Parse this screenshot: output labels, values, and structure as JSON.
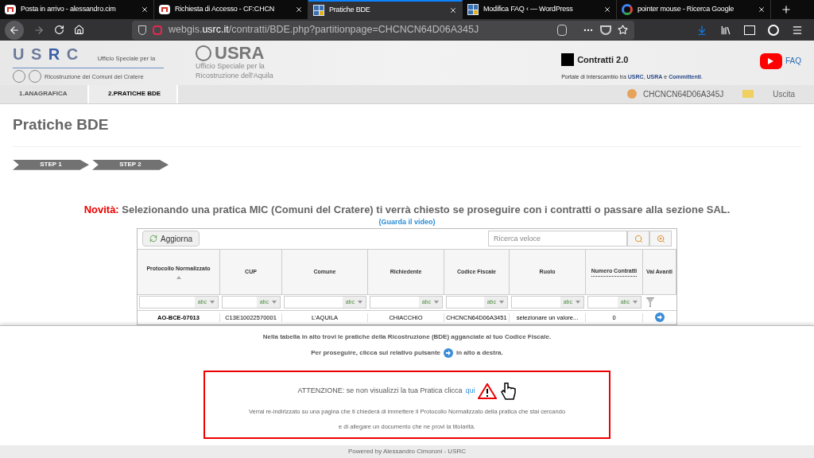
{
  "browser": {
    "tabs": [
      {
        "title": "Posta in arrivo - alessandro.cim",
        "selected": false
      },
      {
        "title": "Richiesta di Accesso - CF:CHCN",
        "selected": false
      },
      {
        "title": "Pratiche BDE",
        "selected": true
      },
      {
        "title": "Modifica FAQ ‹ — WordPress",
        "selected": false
      },
      {
        "title": "pointer mouse - Ricerca Google",
        "selected": false
      }
    ],
    "url": "webgis.**usrc.it**/contratti/BDE.php?partitionpage=CHCNCN64D06A345J"
  },
  "header": {
    "usrc_logo": {
      "letters": [
        "U",
        "S",
        "R",
        "C"
      ],
      "line1": "Ufficio Speciale per la",
      "line2": "Ricostruzione dei Comuni del Cratere"
    },
    "usra_logo": {
      "mark": "USRA",
      "line1": "Ufficio Speciale per la",
      "line2": "Ricostruzione dell'Aquila"
    },
    "portal": {
      "title": "Contratti 2.0",
      "subtitle": "Portale di Interscambio tra **USRC**, **USRA** e **Committenti**."
    },
    "faq": "FAQ"
  },
  "nav": {
    "steps": [
      {
        "label": "1.ANAGRAFICA",
        "selected": false
      },
      {
        "label": "2.PRATICHE BDE",
        "selected": true
      }
    ],
    "user": "CHCNCN64D06A345J",
    "logout": "Uscita"
  },
  "page": {
    "title": "Pratiche BDE",
    "steps": [
      "STEP 1",
      "STEP 2"
    ],
    "notice": {
      "label": "Novità:",
      "text": "Selezionando una pratica MIC (Comuni del Cratere) ti verrà chiesto se proseguire con i contratti o passare alla sezione SAL."
    },
    "video_link": "(Guarda il video)"
  },
  "grid": {
    "refresh": "Aggiorna",
    "search": {
      "placeholder": "Ricerca veloce"
    },
    "columns": [
      {
        "label": "Protocollo Normalizzato",
        "sorted": true,
        "filter": "abc"
      },
      {
        "label": "CUP",
        "sorted": false,
        "filter": "abc"
      },
      {
        "label": "Comune",
        "sorted": false,
        "filter": "abc"
      },
      {
        "label": "Richiedente",
        "sorted": false,
        "filter": "abc"
      },
      {
        "label": "Codice Fiscale",
        "sorted": false,
        "filter": "abc"
      },
      {
        "label": "Ruolo",
        "sorted": false,
        "filter": "abc"
      },
      {
        "label": "Numero Contratti",
        "sorted": false,
        "filter": "abc"
      },
      {
        "label": "Vai Avanti",
        "sorted": false
      }
    ],
    "rows": [
      {
        "cells": [
          "AO-BCE-07013",
          "C13E10022570001",
          "L'AQUILA",
          "CHIACCHIO",
          "CHCNCN64D06A3451",
          "selezionare un valore...",
          "0"
        ]
      }
    ]
  },
  "help": {
    "line1": "Nella tabella in alto trovi le pratiche della Ricostruzione (BDE) agganciate al tuo Codice Fiscale.",
    "line2_before": "Per proseguire, clicca sul relativo pulsante",
    "line2_after": "in alto a destra.",
    "attention": "ATTENZIONE: se non visualizzi la tua Pratica clicca",
    "attention_link": "qui",
    "detail1": "Verrai re-indirizzato su una pagina che ti chiederà di immettere il Protocollo Normalizzato della pratica che stai cercando",
    "detail2": "e di allegare un documento che ne provi la titolarità."
  },
  "footer": "Powered by Alessandro Cimoroni - USRC"
}
